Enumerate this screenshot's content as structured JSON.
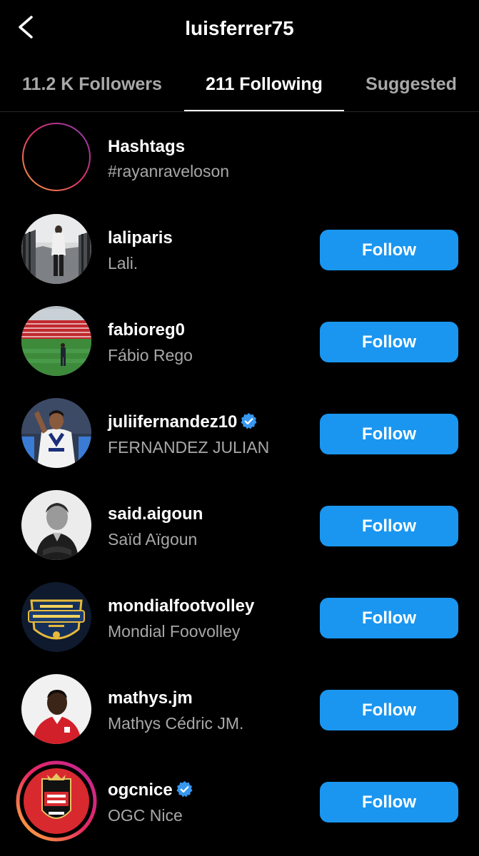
{
  "header": {
    "title": "luisferrer75",
    "back_icon": "chevron-left-icon"
  },
  "tabs": [
    {
      "label": "11.2 K Followers",
      "active": false
    },
    {
      "label": "211 Following",
      "active": true
    },
    {
      "label": "Suggested",
      "active": false
    }
  ],
  "hashtags": {
    "title": "Hashtags",
    "subtitle": "#rayanraveloson",
    "icon": "hashtag-icon"
  },
  "accounts": [
    {
      "username": "laliparis",
      "full_name": "Lali.",
      "verified": false,
      "button": "Follow"
    },
    {
      "username": "fabioreg0",
      "full_name": "Fábio Rego",
      "verified": false,
      "button": "Follow"
    },
    {
      "username": "juliifernandez10",
      "full_name": "FERNANDEZ JULIAN",
      "verified": true,
      "button": "Follow"
    },
    {
      "username": "said.aigoun",
      "full_name": "Saïd Aïgoun",
      "verified": false,
      "button": "Follow"
    },
    {
      "username": "mondialfootvolley",
      "full_name": "Mondial Foovolley",
      "verified": false,
      "button": "Follow"
    },
    {
      "username": "mathys.jm",
      "full_name": "Mathys Cédric JM.",
      "verified": false,
      "button": "Follow"
    },
    {
      "username": "ogcnice",
      "full_name": "OGC Nice",
      "verified": true,
      "button": "Follow"
    }
  ],
  "colors": {
    "background": "#000000",
    "accent_button": "#1a96f0",
    "secondary_text": "#a8a8a8",
    "verified_badge": "#3897f0"
  }
}
